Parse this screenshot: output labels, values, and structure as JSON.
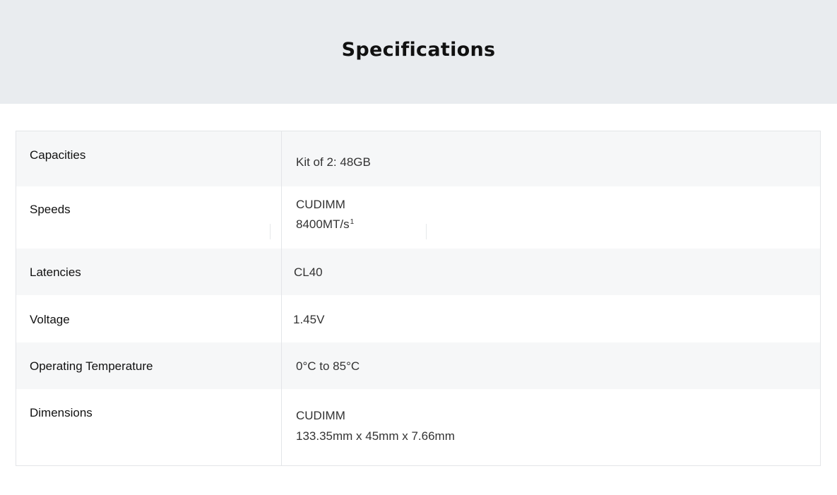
{
  "page": {
    "title": "Specifications"
  },
  "specs": [
    {
      "label": "Capacities",
      "values": [
        "Kit of 2: 48GB"
      ]
    },
    {
      "label": "Speeds",
      "values": [
        "CUDIMM",
        "8400MT/s"
      ],
      "footnote": "1"
    },
    {
      "label": "Latencies",
      "values": [
        "CL40"
      ]
    },
    {
      "label": "Voltage",
      "values": [
        "1.45V"
      ]
    },
    {
      "label": "Operating Temperature",
      "values": [
        "0°C to 85°C"
      ]
    },
    {
      "label": "Dimensions",
      "values": [
        "CUDIMM",
        "133.35mm x 45mm x 7.66mm"
      ]
    }
  ],
  "colors": {
    "header_bg": "#e9ecef",
    "row_shade": "#f6f7f8",
    "border": "#e3e5e8"
  }
}
